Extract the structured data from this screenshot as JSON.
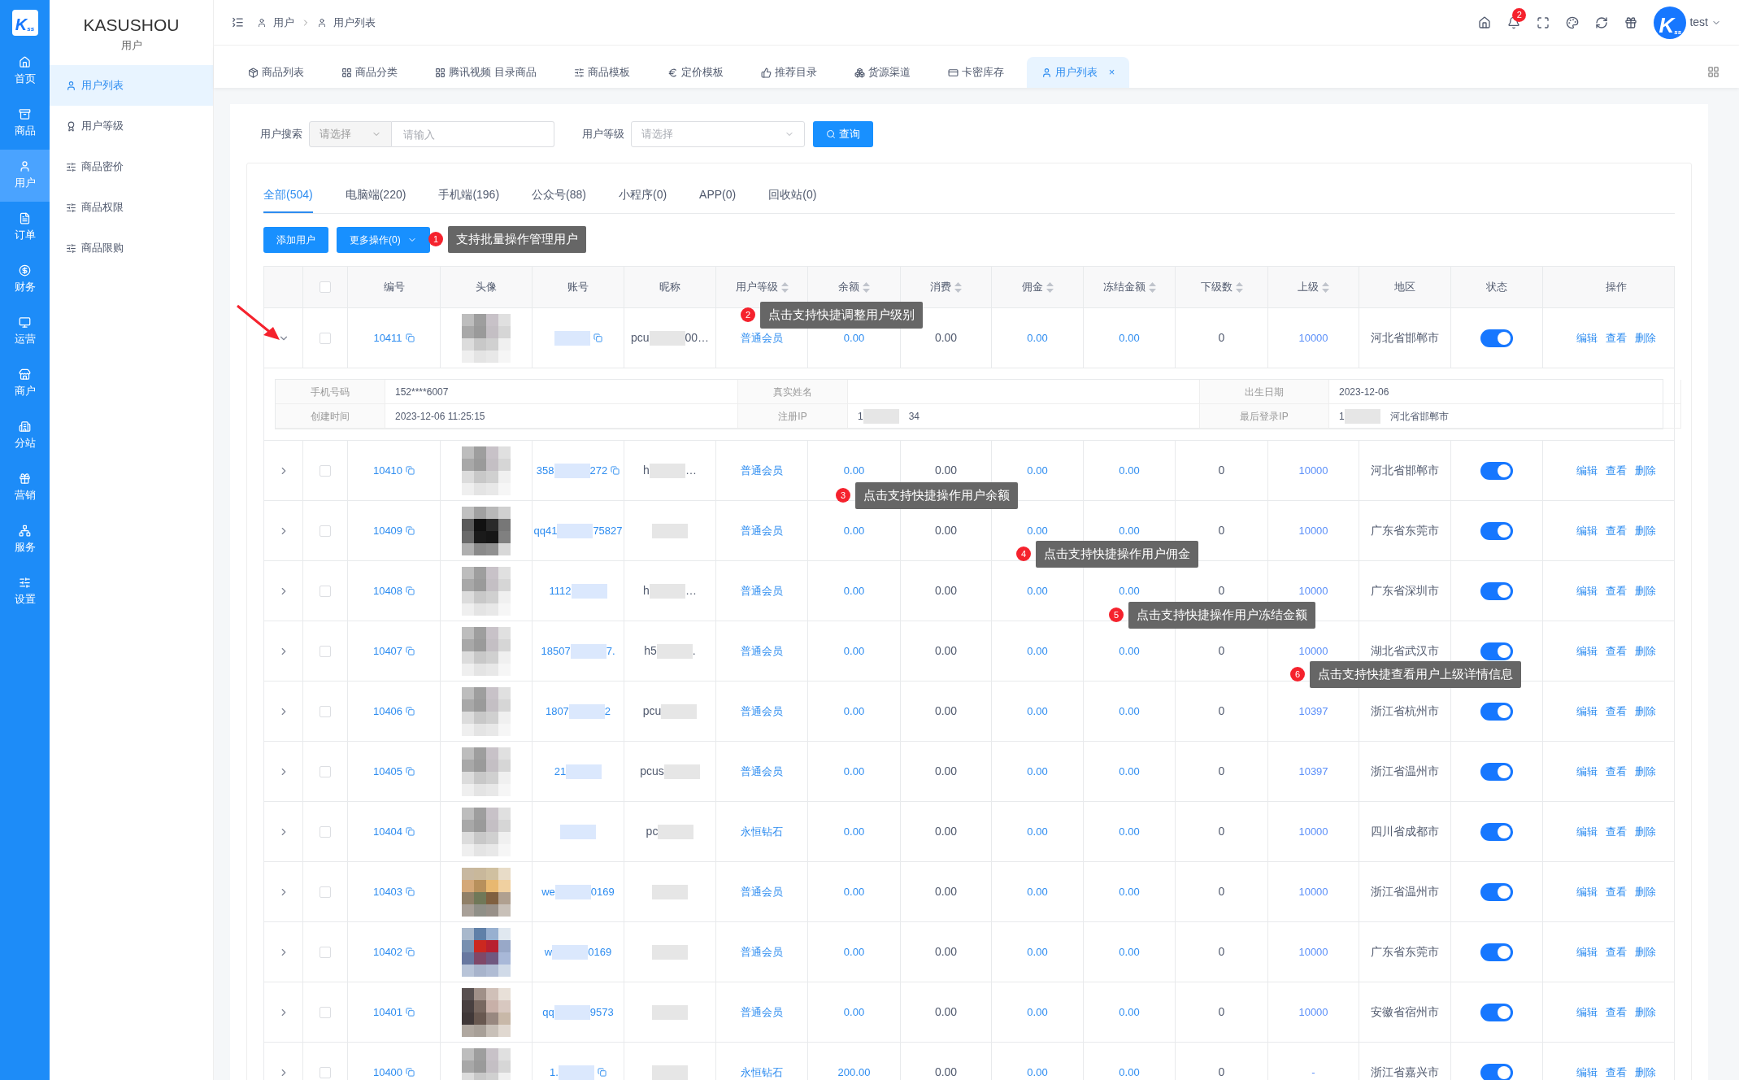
{
  "logo": {
    "letter": "K",
    "sub": "ss"
  },
  "rail": [
    {
      "label": "首页",
      "selected": false
    },
    {
      "label": "商品",
      "selected": false
    },
    {
      "label": "用户",
      "selected": true
    },
    {
      "label": "订单",
      "selected": false
    },
    {
      "label": "财务",
      "selected": false
    },
    {
      "label": "运营",
      "selected": false
    },
    {
      "label": "商户",
      "selected": false
    },
    {
      "label": "分站",
      "selected": false
    },
    {
      "label": "营销",
      "selected": false
    },
    {
      "label": "服务",
      "selected": false
    },
    {
      "label": "设置",
      "selected": false
    }
  ],
  "sidebar": {
    "brand": "KASUSHOU",
    "section": "用户",
    "items": [
      {
        "label": "用户列表",
        "selected": true
      },
      {
        "label": "用户等级",
        "selected": false
      },
      {
        "label": "商品密价",
        "selected": false
      },
      {
        "label": "商品权限",
        "selected": false
      },
      {
        "label": "商品限购",
        "selected": false
      }
    ]
  },
  "breadcrumb": [
    "用户",
    "用户列表"
  ],
  "header": {
    "notifications": "2",
    "user": "test",
    "avatar": {
      "letter": "K",
      "sub": "ss"
    }
  },
  "tabs": [
    {
      "label": "商品列表",
      "selected": false
    },
    {
      "label": "商品分类",
      "selected": false
    },
    {
      "label": "腾讯视频 目录商品",
      "selected": false
    },
    {
      "label": "商品模板",
      "selected": false
    },
    {
      "label": "定价模板",
      "selected": false
    },
    {
      "label": "推荐目录",
      "selected": false
    },
    {
      "label": "货源渠道",
      "selected": false
    },
    {
      "label": "卡密库存",
      "selected": false
    },
    {
      "label": "用户列表",
      "selected": true,
      "close": "×"
    }
  ],
  "filters": {
    "search_label": "用户搜索",
    "type_placeholder": "请选择",
    "input_placeholder": "请输入",
    "level_label": "用户等级",
    "level_placeholder": "请选择",
    "query_button": "查询"
  },
  "subtabs": [
    {
      "label": "全部(504)",
      "selected": true
    },
    {
      "label": "电脑端(220)",
      "selected": false
    },
    {
      "label": "手机端(196)",
      "selected": false
    },
    {
      "label": "公众号(88)",
      "selected": false
    },
    {
      "label": "小程序(0)",
      "selected": false
    },
    {
      "label": "APP(0)",
      "selected": false
    },
    {
      "label": "回收站(0)",
      "selected": false
    }
  ],
  "actions": {
    "add": "添加用户",
    "more": "更多操作(0)"
  },
  "callouts": [
    {
      "number": "1",
      "text": "支持批量操作管理用户"
    },
    {
      "number": "2",
      "text": "点击支持快捷调整用户级别"
    },
    {
      "number": "3",
      "text": "点击支持快捷操作用户余额"
    },
    {
      "number": "4",
      "text": "点击支持快捷操作用户佣金"
    },
    {
      "number": "5",
      "text": "点击支持快捷操作用户冻结金额"
    },
    {
      "number": "6",
      "text": "点击支持快捷查看用户上级详情信息"
    }
  ],
  "table": {
    "all_checked": false,
    "columns": [
      {
        "label": "编号",
        "sortable": false
      },
      {
        "label": "头像",
        "sortable": false
      },
      {
        "label": "账号",
        "sortable": false
      },
      {
        "label": "昵称",
        "sortable": false
      },
      {
        "label": "用户等级",
        "sortable": true
      },
      {
        "label": "余额",
        "sortable": true
      },
      {
        "label": "消费",
        "sortable": true
      },
      {
        "label": "佣金",
        "sortable": true
      },
      {
        "label": "冻结金额",
        "sortable": true
      },
      {
        "label": "下级数",
        "sortable": true
      },
      {
        "label": "上级",
        "sortable": true
      },
      {
        "label": "地区",
        "sortable": false
      },
      {
        "label": "状态",
        "sortable": false
      },
      {
        "label": "操作",
        "sortable": false
      }
    ],
    "rows": [
      {
        "id": "10411",
        "expanded": true,
        "checked": false,
        "account": {
          "copy": true
        },
        "nickname": {
          "pre": "pcu",
          "post": "00…"
        },
        "level": "普通会员",
        "balance": "0.00",
        "spend": "0.00",
        "commission": "0.00",
        "frozen": "0.00",
        "subs": "0",
        "parent": "10000",
        "region": "河北省邯郸市",
        "on": true,
        "actions": [
          "编辑",
          "查看",
          "删除"
        ],
        "detail": [
          {
            "label": "手机号码",
            "value": "152****6007"
          },
          {
            "label": "真实姓名"
          },
          {
            "label": "出生日期",
            "value": "2023-12-06"
          },
          {
            "label": "创建时间",
            "value": "2023-12-06 11:25:15"
          },
          {
            "label": "注册IP",
            "pre": "1",
            "post": "34"
          },
          {
            "label": "最后登录IP",
            "pre": "1",
            "post": "河北省邯郸市"
          }
        ]
      },
      {
        "id": "10410",
        "expanded": false,
        "checked": false,
        "account": {
          "pre": "358",
          "post": "272",
          "copy": true
        },
        "nickname": {
          "pre": "h",
          "post": "…"
        },
        "level": "普通会员",
        "balance": "0.00",
        "spend": "0.00",
        "commission": "0.00",
        "frozen": "0.00",
        "subs": "0",
        "parent": "10000",
        "region": "河北省邯郸市",
        "on": true,
        "actions": [
          "编辑",
          "查看",
          "删除"
        ]
      },
      {
        "id": "10409",
        "expanded": false,
        "checked": false,
        "account": {
          "pre": "qq41",
          "post": "75827"
        },
        "nickname": {},
        "level": "普通会员",
        "balance": "0.00",
        "spend": "0.00",
        "commission": "0.00",
        "frozen": "0.00",
        "subs": "0",
        "parent": "10000",
        "region": "广东省东莞市",
        "on": true,
        "actions": [
          "编辑",
          "查看",
          "删除"
        ]
      },
      {
        "id": "10408",
        "expanded": false,
        "checked": false,
        "account": {
          "pre": "1112"
        },
        "nickname": {
          "pre": "h",
          "post": "…"
        },
        "level": "普通会员",
        "balance": "0.00",
        "spend": "0.00",
        "commission": "0.00",
        "frozen": "0.00",
        "subs": "0",
        "parent": "10000",
        "region": "广东省深圳市",
        "on": true,
        "actions": [
          "编辑",
          "查看",
          "删除"
        ]
      },
      {
        "id": "10407",
        "expanded": false,
        "checked": false,
        "account": {
          "pre": "18507",
          "post": "7."
        },
        "nickname": {
          "pre": "h5",
          "post": "."
        },
        "level": "普通会员",
        "balance": "0.00",
        "spend": "0.00",
        "commission": "0.00",
        "frozen": "0.00",
        "subs": "0",
        "parent": "10000",
        "region": "湖北省武汉市",
        "on": true,
        "actions": [
          "编辑",
          "查看",
          "删除"
        ]
      },
      {
        "id": "10406",
        "expanded": false,
        "checked": false,
        "account": {
          "pre": "1807",
          "post": "2"
        },
        "nickname": {
          "pre": "pcu"
        },
        "level": "普通会员",
        "balance": "0.00",
        "spend": "0.00",
        "commission": "0.00",
        "frozen": "0.00",
        "subs": "0",
        "parent": "10397",
        "region": "浙江省杭州市",
        "on": true,
        "actions": [
          "编辑",
          "查看",
          "删除"
        ]
      },
      {
        "id": "10405",
        "expanded": false,
        "checked": false,
        "account": {
          "pre": "21"
        },
        "nickname": {
          "pre": "pcus"
        },
        "level": "普通会员",
        "balance": "0.00",
        "spend": "0.00",
        "commission": "0.00",
        "frozen": "0.00",
        "subs": "0",
        "parent": "10397",
        "region": "浙江省温州市",
        "on": true,
        "actions": [
          "编辑",
          "查看",
          "删除"
        ]
      },
      {
        "id": "10404",
        "expanded": false,
        "checked": false,
        "account": {},
        "nickname": {
          "pre": "pc"
        },
        "level": "永恒钻石",
        "balance": "0.00",
        "spend": "0.00",
        "commission": "0.00",
        "frozen": "0.00",
        "subs": "0",
        "parent": "10000",
        "region": "四川省成都市",
        "on": true,
        "actions": [
          "编辑",
          "查看",
          "删除"
        ]
      },
      {
        "id": "10403",
        "expanded": false,
        "checked": false,
        "account": {
          "pre": "we",
          "post": "0169"
        },
        "nickname": {},
        "level": "普通会员",
        "balance": "0.00",
        "spend": "0.00",
        "commission": "0.00",
        "frozen": "0.00",
        "subs": "0",
        "parent": "10000",
        "region": "浙江省温州市",
        "on": true,
        "actions": [
          "编辑",
          "查看",
          "删除"
        ]
      },
      {
        "id": "10402",
        "expanded": false,
        "checked": false,
        "account": {
          "pre": "w",
          "post": "0169"
        },
        "nickname": {},
        "level": "普通会员",
        "balance": "0.00",
        "spend": "0.00",
        "commission": "0.00",
        "frozen": "0.00",
        "subs": "0",
        "parent": "10000",
        "region": "广东省东莞市",
        "on": true,
        "actions": [
          "编辑",
          "查看",
          "删除"
        ]
      },
      {
        "id": "10401",
        "expanded": false,
        "checked": false,
        "account": {
          "pre": "qq",
          "post": "9573"
        },
        "nickname": {},
        "level": "普通会员",
        "balance": "0.00",
        "spend": "0.00",
        "commission": "0.00",
        "frozen": "0.00",
        "subs": "0",
        "parent": "10000",
        "region": "安徽省宿州市",
        "on": true,
        "actions": [
          "编辑",
          "查看",
          "删除"
        ]
      },
      {
        "id": "10400",
        "expanded": false,
        "checked": false,
        "account": {
          "pre": "1.",
          "copy": true
        },
        "nickname": {},
        "level": "永恒钻石",
        "balance": "200.00",
        "spend": "0.00",
        "commission": "0.00",
        "frozen": "0.00",
        "subs": "0",
        "parent": "-",
        "region": "浙江省嘉兴市",
        "on": true,
        "actions": [
          "编辑",
          "查看",
          "删除"
        ]
      }
    ]
  }
}
